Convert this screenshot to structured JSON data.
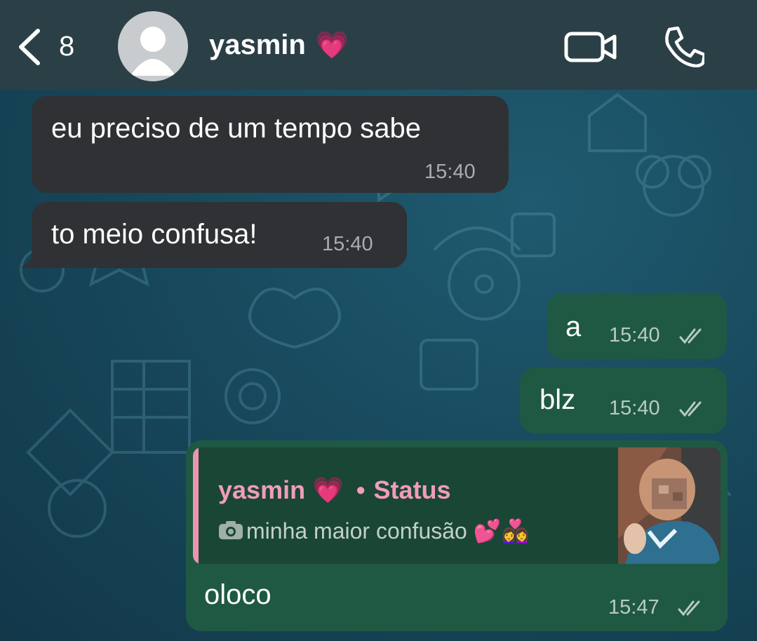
{
  "header": {
    "unread_count": "8",
    "contact_name": "yasmin",
    "contact_emoji": "💗",
    "icons": [
      "back-chevron-icon",
      "avatar-placeholder-icon",
      "video-camera-icon",
      "phone-icon"
    ]
  },
  "messages": [
    {
      "direction": "in",
      "text": "eu preciso de um tempo sabe",
      "time": "15:40"
    },
    {
      "direction": "in",
      "text": "to meio confusa!",
      "time": "15:40"
    },
    {
      "direction": "out",
      "text": "a",
      "time": "15:40",
      "status": "read"
    },
    {
      "direction": "out",
      "text": "blz",
      "time": "15:40",
      "status": "read"
    },
    {
      "direction": "out",
      "text": "oloco",
      "time": "15:47",
      "status": "read",
      "reply": {
        "author": "yasmin 💗",
        "separator": "•",
        "label": "Status",
        "text": "minha maior confusão 💕👩‍❤️‍👩",
        "media_icon": "camera-icon"
      }
    }
  ],
  "colors": {
    "header_bg": "#2b3f46",
    "chat_bg": "#174659",
    "incoming_bubble": "#2f3134",
    "outgoing_bubble": "#1f5944",
    "status_accent": "#f19cba"
  }
}
